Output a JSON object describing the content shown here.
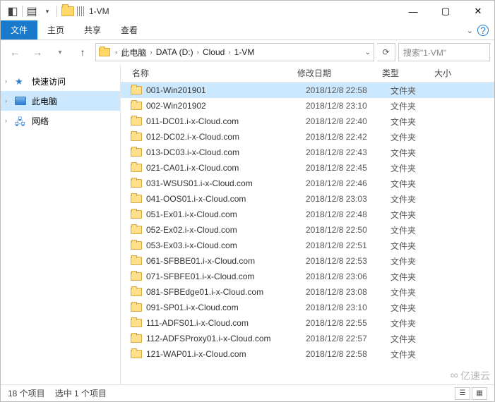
{
  "titlebar": {
    "title": "1-VM"
  },
  "ribbon": {
    "tab_file": "文件",
    "tab_home": "主页",
    "tab_share": "共享",
    "tab_view": "查看"
  },
  "breadcrumb": {
    "seg_pc": "此电脑",
    "seg_drive": "DATA (D:)",
    "seg_cloud": "Cloud",
    "seg_folder": "1-VM"
  },
  "search": {
    "placeholder": "搜索\"1-VM\""
  },
  "nav": {
    "quick": "快速访问",
    "pc": "此电脑",
    "network": "网络"
  },
  "columns": {
    "name": "名称",
    "modified": "修改日期",
    "type": "类型",
    "size": "大小"
  },
  "type_folder": "文件夹",
  "rows": [
    {
      "name": "001-Win201901",
      "date": "2018/12/8 22:58",
      "selected": true
    },
    {
      "name": "002-Win201902",
      "date": "2018/12/8 23:10"
    },
    {
      "name": "011-DC01.i-x-Cloud.com",
      "date": "2018/12/8 22:40"
    },
    {
      "name": "012-DC02.i-x-Cloud.com",
      "date": "2018/12/8 22:42"
    },
    {
      "name": "013-DC03.i-x-Cloud.com",
      "date": "2018/12/8 22:43"
    },
    {
      "name": "021-CA01.i-x-Cloud.com",
      "date": "2018/12/8 22:45"
    },
    {
      "name": "031-WSUS01.i-x-Cloud.com",
      "date": "2018/12/8 22:46"
    },
    {
      "name": "041-OOS01.i-x-Cloud.com",
      "date": "2018/12/8 23:03"
    },
    {
      "name": "051-Ex01.i-x-Cloud.com",
      "date": "2018/12/8 22:48"
    },
    {
      "name": "052-Ex02.i-x-Cloud.com",
      "date": "2018/12/8 22:50"
    },
    {
      "name": "053-Ex03.i-x-Cloud.com",
      "date": "2018/12/8 22:51"
    },
    {
      "name": "061-SFBBE01.i-x-Cloud.com",
      "date": "2018/12/8 22:53"
    },
    {
      "name": "071-SFBFE01.i-x-Cloud.com",
      "date": "2018/12/8 23:06"
    },
    {
      "name": "081-SFBEdge01.i-x-Cloud.com",
      "date": "2018/12/8 23:08"
    },
    {
      "name": "091-SP01.i-x-Cloud.com",
      "date": "2018/12/8 23:10"
    },
    {
      "name": "111-ADFS01.i-x-Cloud.com",
      "date": "2018/12/8 22:55"
    },
    {
      "name": "112-ADFSProxy01.i-x-Cloud.com",
      "date": "2018/12/8 22:57"
    },
    {
      "name": "121-WAP01.i-x-Cloud.com",
      "date": "2018/12/8 22:58"
    }
  ],
  "status": {
    "items": "18 个项目",
    "selected": "选中 1 个项目"
  },
  "watermark": "亿速云"
}
